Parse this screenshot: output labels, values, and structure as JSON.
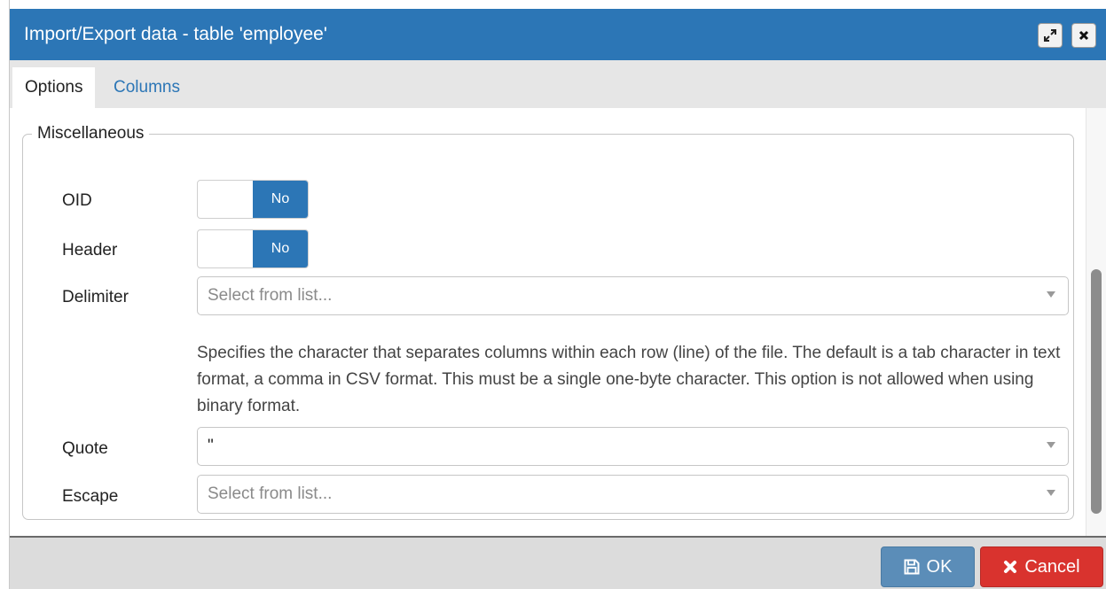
{
  "dialog": {
    "title": "Import/Export data - table 'employee'",
    "maximize_icon": "expand-icon",
    "close_icon": "close-icon"
  },
  "tabs": [
    {
      "label": "Options",
      "active": true
    },
    {
      "label": "Columns",
      "active": false
    }
  ],
  "miscellaneous": {
    "legend": "Miscellaneous",
    "oid": {
      "label": "OID",
      "value": "No"
    },
    "header": {
      "label": "Header",
      "value": "No"
    },
    "delimiter": {
      "label": "Delimiter",
      "placeholder": "Select from list...",
      "help": "Specifies the character that separates columns within each row (line) of the file. The default is a tab character in text format, a comma in CSV format. This must be a single one-byte character. This option is not allowed when using binary format."
    },
    "quote": {
      "label": "Quote",
      "value": "\""
    },
    "escape": {
      "label": "Escape",
      "placeholder": "Select from list..."
    }
  },
  "footer": {
    "ok_label": "OK",
    "cancel_label": "Cancel"
  },
  "colors": {
    "primary": "#2c76b6",
    "ok_button": "#5b8db8",
    "cancel_button": "#d9332e"
  }
}
